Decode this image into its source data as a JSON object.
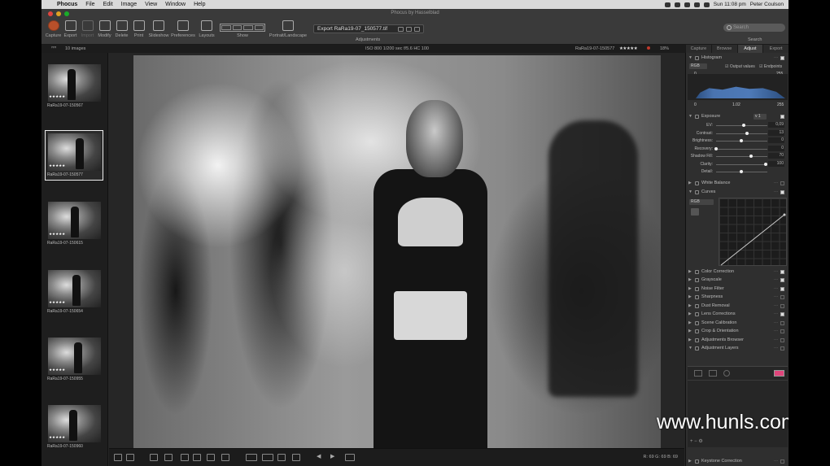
{
  "menubar": {
    "app_name": "Phocus",
    "items": [
      "File",
      "Edit",
      "Image",
      "View",
      "Window",
      "Help"
    ],
    "clock": "Sun 11:08 pm",
    "user": "Peter Coulson"
  },
  "window": {
    "title": "Phocus by Hasselblad"
  },
  "toolbar": {
    "buttons": [
      {
        "label": "Capture",
        "icon": "capture-icon"
      },
      {
        "label": "Export",
        "icon": "export-icon"
      },
      {
        "label": "Import",
        "icon": "import-icon"
      },
      {
        "label": "Modify",
        "icon": "modify-icon"
      },
      {
        "label": "Delete",
        "icon": "delete-icon"
      },
      {
        "label": "Print",
        "icon": "print-icon"
      },
      {
        "label": "Slideshow",
        "icon": "slideshow-icon"
      },
      {
        "label": "Preferences",
        "icon": "preferences-icon"
      },
      {
        "label": "Layouts",
        "icon": "layouts-icon"
      }
    ],
    "show_label": "Show",
    "portrait_label": "Portrait/Landscape",
    "export_file": "Export RaRa19-07_150577.tif",
    "adjustments_label": "Adjustments",
    "search_placeholder": "Search",
    "search_label": "Search"
  },
  "infobar": {
    "image_count": "10 images",
    "exif": "ISO 800   1/200 sec   f/5.6   HC 100",
    "file_name": "RaRa19-07-150577",
    "rating": "★★★★★",
    "zoom": "18%"
  },
  "panel_tabs": [
    {
      "label": "Capture",
      "active": false
    },
    {
      "label": "Browse",
      "active": false
    },
    {
      "label": "Adjust",
      "active": true
    },
    {
      "label": "Export",
      "active": false
    }
  ],
  "thumbnails": [
    {
      "name": "RaRa19-07-150567",
      "stars": "★★★★★",
      "selected": false
    },
    {
      "name": "RaRa19-07-150577",
      "stars": "★★★★★",
      "selected": true
    },
    {
      "name": "RaRa19-07-150615",
      "stars": "★★★★★",
      "selected": false
    },
    {
      "name": "RaRa19-07-150654",
      "stars": "★★★★★",
      "selected": false
    },
    {
      "name": "RaRa19-07-150955",
      "stars": "★★★★★",
      "selected": false
    },
    {
      "name": "RaRa19-07-150960",
      "stars": "★★★★★",
      "selected": false
    }
  ],
  "histogram": {
    "title": "Histogram",
    "channel": "RGB",
    "output_values_label": "Output values",
    "endpoints_label": "Endpoints",
    "top_left": "0",
    "top_right": "255",
    "bottom_left": "0",
    "bottom_mid": "1.02",
    "bottom_right": "255"
  },
  "exposure": {
    "title": "Exposure",
    "preset": "v 1",
    "sliders": [
      {
        "label": "EV:",
        "value": "0,09",
        "pos": 0.55
      },
      {
        "label": "Contrast:",
        "value": "13",
        "pos": 0.62
      },
      {
        "label": "Brightness:",
        "value": "0",
        "pos": 0.5
      },
      {
        "label": "Recovery:",
        "value": "0",
        "pos": 0.0
      },
      {
        "label": "Shadow Fill:",
        "value": "70",
        "pos": 0.7
      },
      {
        "label": "Clarity:",
        "value": "100",
        "pos": 1.0
      },
      {
        "label": "Detail:",
        "value": "",
        "pos": 0.5
      }
    ]
  },
  "sections": [
    {
      "name": "White Balance",
      "open": false,
      "checked": false
    },
    {
      "name": "Curves",
      "open": true,
      "checked": true
    },
    {
      "name": "Color Correction",
      "open": false,
      "checked": true
    },
    {
      "name": "Grayscale",
      "open": false,
      "checked": true
    },
    {
      "name": "Noise Filter",
      "open": false,
      "checked": true
    },
    {
      "name": "Sharpness",
      "open": false,
      "checked": false
    },
    {
      "name": "Dust Removal",
      "open": false,
      "checked": false
    },
    {
      "name": "Lens Corrections",
      "open": false,
      "checked": true
    },
    {
      "name": "Scene Calibration",
      "open": false,
      "checked": false
    },
    {
      "name": "Crop & Orientation",
      "open": false,
      "checked": false
    },
    {
      "name": "Adjustments Browser",
      "open": false,
      "checked": false
    },
    {
      "name": "Adjustment Layers",
      "open": true,
      "checked": false
    }
  ],
  "curves_channel": "RGB",
  "keystone": "Keystone Correction",
  "readout": "R: 69  G: 69  B: 69",
  "watermark": "www.hunls.com",
  "colors": {
    "accent_pink": "#e0457b",
    "selected_border": "#eeeeee",
    "histogram_blue": "#4a74b0"
  }
}
